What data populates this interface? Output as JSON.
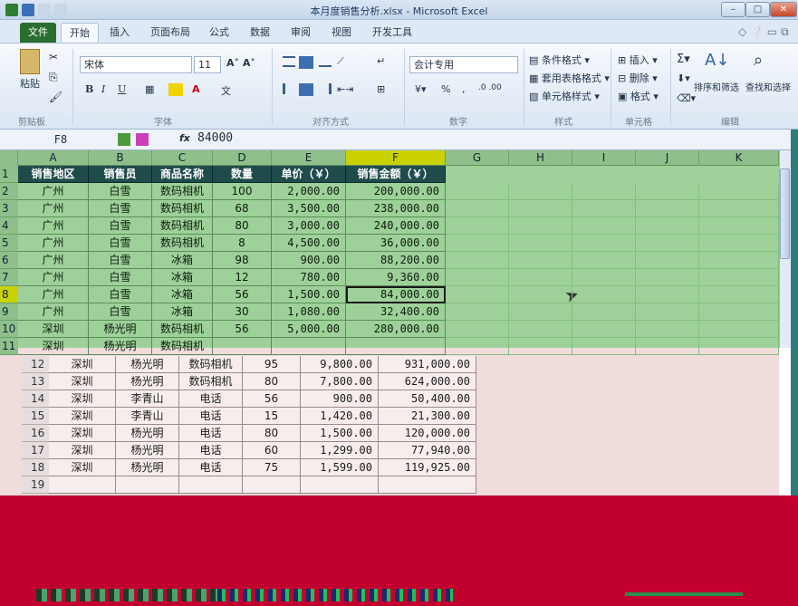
{
  "app": {
    "title": "本月度销售分析.xlsx - Microsoft Excel"
  },
  "tabs": [
    {
      "label": "文件"
    },
    {
      "label": "开始"
    },
    {
      "label": "插入"
    },
    {
      "label": "页面布局"
    },
    {
      "label": "公式"
    },
    {
      "label": "数据"
    },
    {
      "label": "审阅"
    },
    {
      "label": "视图"
    },
    {
      "label": "开发工具"
    }
  ],
  "ribbon": {
    "clipboard": {
      "paste": "粘贴",
      "label": "剪贴板"
    },
    "font": {
      "name": "宋体",
      "size": "11",
      "label": "字体",
      "bold": "B",
      "italic": "I",
      "underline": "U"
    },
    "alignment": {
      "label": "对齐方式"
    },
    "number": {
      "format": "会计专用",
      "label": "数字",
      "percent": "%"
    },
    "styles": {
      "conditional": "条件格式",
      "table": "套用表格格式",
      "cell": "单元格样式",
      "label": "样式"
    },
    "cells": {
      "insert": "插入",
      "delete": "删除",
      "format": "格式",
      "label": "单元格"
    },
    "editing": {
      "sort": "排序和筛选",
      "find": "查找和选择",
      "label": "编辑"
    }
  },
  "formula_bar": {
    "name_box": "F8",
    "fx": "fx",
    "value": "84000"
  },
  "columns": [
    "A",
    "B",
    "C",
    "D",
    "E",
    "F",
    "G",
    "H",
    "I",
    "J",
    "K"
  ],
  "header_row": [
    "销售地区",
    "销售员",
    "商品名称",
    "数量",
    "单价（￥）",
    "销售金额（￥）"
  ],
  "rows_top": [
    {
      "n": "2",
      "c": [
        "广州",
        "白雪",
        "数码相机",
        "100",
        "2,000.00",
        "200,000.00"
      ]
    },
    {
      "n": "3",
      "c": [
        "广州",
        "白雪",
        "数码相机",
        "68",
        "3,500.00",
        "238,000.00"
      ]
    },
    {
      "n": "4",
      "c": [
        "广州",
        "白雪",
        "数码相机",
        "80",
        "3,000.00",
        "240,000.00"
      ]
    },
    {
      "n": "5",
      "c": [
        "广州",
        "白雪",
        "数码相机",
        "8",
        "4,500.00",
        "36,000.00"
      ]
    },
    {
      "n": "6",
      "c": [
        "广州",
        "白雪",
        "冰箱",
        "98",
        "900.00",
        "88,200.00"
      ]
    },
    {
      "n": "7",
      "c": [
        "广州",
        "白雪",
        "冰箱",
        "12",
        "780.00",
        "9,360.00"
      ]
    },
    {
      "n": "8",
      "c": [
        "广州",
        "白雪",
        "冰箱",
        "56",
        "1,500.00",
        "84,000.00"
      ]
    },
    {
      "n": "9",
      "c": [
        "广州",
        "白雪",
        "冰箱",
        "30",
        "1,080.00",
        "32,400.00"
      ]
    },
    {
      "n": "10",
      "c": [
        "深圳",
        "杨光明",
        "数码相机",
        "56",
        "5,000.00",
        "280,000.00"
      ]
    },
    {
      "n": "11",
      "c": [
        "深圳",
        "杨光明",
        "数码相机",
        "",
        "",
        ""
      ]
    }
  ],
  "rows_bottom": [
    {
      "n": "12",
      "c": [
        "深圳",
        "杨光明",
        "数码相机",
        "95",
        "9,800.00",
        "931,000.00"
      ]
    },
    {
      "n": "13",
      "c": [
        "深圳",
        "杨光明",
        "数码相机",
        "80",
        "7,800.00",
        "624,000.00"
      ]
    },
    {
      "n": "14",
      "c": [
        "深圳",
        "李青山",
        "电话",
        "56",
        "900.00",
        "50,400.00"
      ]
    },
    {
      "n": "15",
      "c": [
        "深圳",
        "李青山",
        "电话",
        "15",
        "1,420.00",
        "21,300.00"
      ]
    },
    {
      "n": "16",
      "c": [
        "深圳",
        "杨光明",
        "电话",
        "80",
        "1,500.00",
        "120,000.00"
      ]
    },
    {
      "n": "17",
      "c": [
        "深圳",
        "杨光明",
        "电话",
        "60",
        "1,299.00",
        "77,940.00"
      ]
    },
    {
      "n": "18",
      "c": [
        "深圳",
        "杨光明",
        "电话",
        "75",
        "1,599.00",
        "119,925.00"
      ]
    },
    {
      "n": "19",
      "c": [
        "",
        "",
        "",
        "",
        "",
        ""
      ]
    }
  ],
  "colors": {
    "grid_green": "#9ed19a",
    "header_dark": "#1f4b4b",
    "selected_col": "#c9d200",
    "pink": "#f1dcdc",
    "red": "#c2002f"
  }
}
